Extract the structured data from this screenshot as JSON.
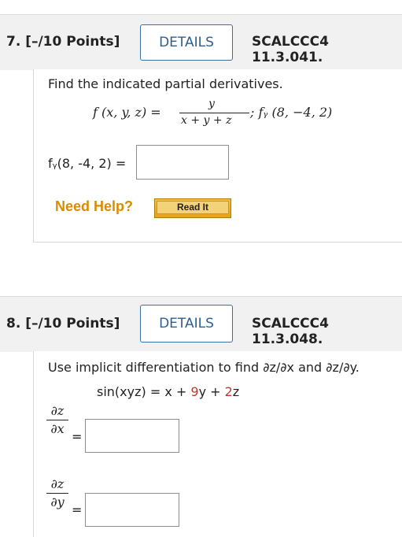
{
  "q7": {
    "number": "7. [–/10 Points]",
    "details": "DETAILS",
    "code": "SCALCCC4 11.3.041.",
    "prompt": "Find the indicated partial derivatives.",
    "formula_lhs": "f (x, y, z) =",
    "formula_num": "y",
    "formula_den": "x + y + z",
    "formula_tail": "; fᵧ (8, −4, 2)",
    "answer_label": "fᵧ(8, -4, 2) =",
    "answer_value": "",
    "need_help": "Need Help?",
    "read_it": "Read It"
  },
  "q8": {
    "number": "8. [–/10 Points]",
    "details": "DETAILS",
    "code": "SCALCCC4 11.3.048.",
    "prompt": "Use implicit differentiation to find ∂z/∂x and ∂z/∂y.",
    "equation_left": "sin(xyz) = x + ",
    "equation_9": "9",
    "equation_mid": "y + ",
    "equation_2": "2",
    "equation_right": "z",
    "dzdx_num": "∂z",
    "dzdx_den": "∂x",
    "dzdy_num": "∂z",
    "dzdy_den": "∂y",
    "eq": "=",
    "answer_x": "",
    "answer_y": ""
  },
  "colors": {
    "accent": "#2d5f93",
    "need_help": "#d98c00",
    "coef": "#c0392b"
  }
}
